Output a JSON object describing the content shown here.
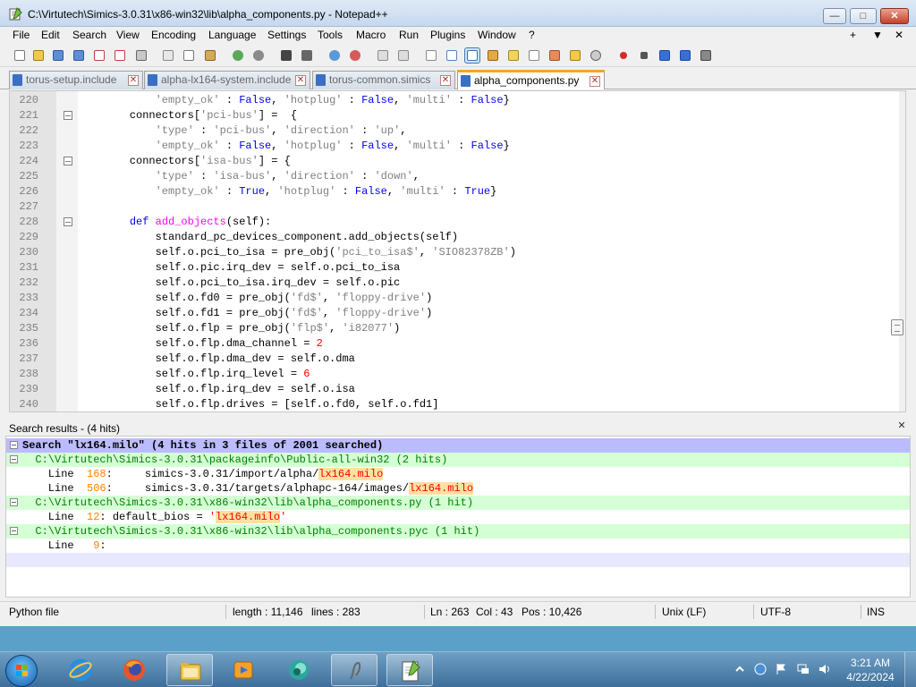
{
  "window": {
    "title": "C:\\Virtutech\\Simics-3.0.31\\x86-win32\\lib\\alpha_components.py - Notepad++",
    "min_label": "—",
    "max_label": "□",
    "close_label": "✕"
  },
  "menu": [
    "File",
    "Edit",
    "Search",
    "View",
    "Encoding",
    "Language",
    "Settings",
    "Tools",
    "Macro",
    "Run",
    "Plugins",
    "Window",
    "?"
  ],
  "menu_right": [
    "+",
    "▼",
    "✕"
  ],
  "tabs": [
    {
      "label": "torus-setup.include"
    },
    {
      "label": "alpha-lx164-system.include"
    },
    {
      "label": "torus-common.simics"
    },
    {
      "label": "alpha_components.py"
    }
  ],
  "code_lines": [
    {
      "n": "220",
      "parts": [
        [
          "p",
          "        "
        ],
        [
          "s",
          "'empty_ok'"
        ],
        [
          "p",
          " : "
        ],
        [
          "k",
          "False"
        ],
        [
          "p",
          ", "
        ],
        [
          "s",
          "'hotplug'"
        ],
        [
          "p",
          " : "
        ],
        [
          "k",
          "False"
        ],
        [
          "p",
          ", "
        ],
        [
          "s",
          "'multi'"
        ],
        [
          "p",
          " : "
        ],
        [
          "k",
          "False"
        ],
        [
          "p",
          "}"
        ]
      ]
    },
    {
      "n": "221",
      "fold": true,
      "parts": [
        [
          "p",
          "    connectors["
        ],
        [
          "s",
          "'pci-bus'"
        ],
        [
          "p",
          "] =  {"
        ]
      ]
    },
    {
      "n": "222",
      "parts": [
        [
          "p",
          "        "
        ],
        [
          "s",
          "'type'"
        ],
        [
          "p",
          " : "
        ],
        [
          "s",
          "'pci-bus'"
        ],
        [
          "p",
          ", "
        ],
        [
          "s",
          "'direction'"
        ],
        [
          "p",
          " : "
        ],
        [
          "s",
          "'up'"
        ],
        [
          "p",
          ","
        ]
      ]
    },
    {
      "n": "223",
      "parts": [
        [
          "p",
          "        "
        ],
        [
          "s",
          "'empty_ok'"
        ],
        [
          "p",
          " : "
        ],
        [
          "k",
          "False"
        ],
        [
          "p",
          ", "
        ],
        [
          "s",
          "'hotplug'"
        ],
        [
          "p",
          " : "
        ],
        [
          "k",
          "False"
        ],
        [
          "p",
          ", "
        ],
        [
          "s",
          "'multi'"
        ],
        [
          "p",
          " : "
        ],
        [
          "k",
          "False"
        ],
        [
          "p",
          "}"
        ]
      ]
    },
    {
      "n": "224",
      "fold": true,
      "parts": [
        [
          "p",
          "    connectors["
        ],
        [
          "s",
          "'isa-bus'"
        ],
        [
          "p",
          "] = {"
        ]
      ]
    },
    {
      "n": "225",
      "parts": [
        [
          "p",
          "        "
        ],
        [
          "s",
          "'type'"
        ],
        [
          "p",
          " : "
        ],
        [
          "s",
          "'isa-bus'"
        ],
        [
          "p",
          ", "
        ],
        [
          "s",
          "'direction'"
        ],
        [
          "p",
          " : "
        ],
        [
          "s",
          "'down'"
        ],
        [
          "p",
          ","
        ]
      ]
    },
    {
      "n": "226",
      "parts": [
        [
          "p",
          "        "
        ],
        [
          "s",
          "'empty_ok'"
        ],
        [
          "p",
          " : "
        ],
        [
          "k",
          "True"
        ],
        [
          "p",
          ", "
        ],
        [
          "s",
          "'hotplug'"
        ],
        [
          "p",
          " : "
        ],
        [
          "k",
          "False"
        ],
        [
          "p",
          ", "
        ],
        [
          "s",
          "'multi'"
        ],
        [
          "p",
          " : "
        ],
        [
          "k",
          "True"
        ],
        [
          "p",
          "}"
        ]
      ]
    },
    {
      "n": "227",
      "parts": []
    },
    {
      "n": "228",
      "fold": true,
      "parts": [
        [
          "p",
          "    "
        ],
        [
          "k",
          "def"
        ],
        [
          "p",
          " "
        ],
        [
          "f",
          "add_objects"
        ],
        [
          "p",
          "(self):"
        ]
      ]
    },
    {
      "n": "229",
      "parts": [
        [
          "p",
          "        standard_pc_devices_component.add_objects(self)"
        ]
      ]
    },
    {
      "n": "230",
      "parts": [
        [
          "p",
          "        self.o.pci_to_isa = pre_obj("
        ],
        [
          "s",
          "'pci_to_isa$'"
        ],
        [
          "p",
          ", "
        ],
        [
          "s",
          "'SIO82378ZB'"
        ],
        [
          "p",
          ")"
        ]
      ]
    },
    {
      "n": "231",
      "parts": [
        [
          "p",
          "        self.o.pic.irq_dev = self.o.pci_to_isa"
        ]
      ]
    },
    {
      "n": "232",
      "parts": [
        [
          "p",
          "        self.o.pci_to_isa.irq_dev = self.o.pic"
        ]
      ]
    },
    {
      "n": "233",
      "parts": [
        [
          "p",
          "        self.o.fd0 = pre_obj("
        ],
        [
          "s",
          "'fd$'"
        ],
        [
          "p",
          ", "
        ],
        [
          "s",
          "'floppy-drive'"
        ],
        [
          "p",
          ")"
        ]
      ]
    },
    {
      "n": "234",
      "parts": [
        [
          "p",
          "        self.o.fd1 = pre_obj("
        ],
        [
          "s",
          "'fd$'"
        ],
        [
          "p",
          ", "
        ],
        [
          "s",
          "'floppy-drive'"
        ],
        [
          "p",
          ")"
        ]
      ]
    },
    {
      "n": "235",
      "parts": [
        [
          "p",
          "        self.o.flp = pre_obj("
        ],
        [
          "s",
          "'flp$'"
        ],
        [
          "p",
          ", "
        ],
        [
          "s",
          "'i82077'"
        ],
        [
          "p",
          ")"
        ]
      ]
    },
    {
      "n": "236",
      "parts": [
        [
          "p",
          "        self.o.flp.dma_channel = "
        ],
        [
          "n",
          "2"
        ]
      ]
    },
    {
      "n": "237",
      "parts": [
        [
          "p",
          "        self.o.flp.dma_dev = self.o.dma"
        ]
      ]
    },
    {
      "n": "238",
      "parts": [
        [
          "p",
          "        self.o.flp.irq_level = "
        ],
        [
          "n",
          "6"
        ]
      ]
    },
    {
      "n": "239",
      "parts": [
        [
          "p",
          "        self.o.flp.irq_dev = self.o.isa"
        ]
      ]
    },
    {
      "n": "240",
      "parts": [
        [
          "p",
          "        self.o.flp.drives = [self.o.fd0, self.o.fd1]"
        ]
      ]
    }
  ],
  "search_results": {
    "title": "Search results - (4 hits)",
    "close_label": "✕",
    "lines": [
      {
        "kind": "search",
        "tree": true,
        "parts": [
          [
            "p",
            "Search \"lx164.milo\" (4 hits in 3 files of 2001 searched)"
          ]
        ]
      },
      {
        "kind": "file",
        "tree": true,
        "parts": [
          [
            "p",
            "  C:\\Virtutech\\Simics-3.0.31\\packageinfo\\Public-all-win32 (2 hits)"
          ]
        ]
      },
      {
        "kind": "line",
        "parts": [
          [
            "p",
            "    Line  "
          ],
          [
            "l",
            "168"
          ],
          [
            "p",
            ":     simics-3.0.31/import/alpha/"
          ],
          [
            "h",
            "lx164.milo"
          ]
        ]
      },
      {
        "kind": "line",
        "parts": [
          [
            "p",
            "    Line  "
          ],
          [
            "l",
            "506"
          ],
          [
            "p",
            ":     simics-3.0.31/targets/alphapc-164/images/"
          ],
          [
            "h",
            "lx164.milo"
          ]
        ]
      },
      {
        "kind": "file",
        "tree": true,
        "parts": [
          [
            "p",
            "  C:\\Virtutech\\Simics-3.0.31\\x86-win32\\lib\\alpha_components.py (1 hit)"
          ]
        ]
      },
      {
        "kind": "line",
        "parts": [
          [
            "p",
            "    Line  "
          ],
          [
            "l",
            "12"
          ],
          [
            "p",
            ": default_bios = "
          ],
          [
            "s",
            "'"
          ],
          [
            "h",
            "lx164.milo"
          ],
          [
            "s",
            "'"
          ]
        ]
      },
      {
        "kind": "file",
        "tree": true,
        "parts": [
          [
            "p",
            "  C:\\Virtutech\\Simics-3.0.31\\x86-win32\\lib\\alpha_components.pyc (1 hit)"
          ]
        ]
      },
      {
        "kind": "line",
        "parts": [
          [
            "p",
            "    Line   "
          ],
          [
            "l",
            "9"
          ],
          [
            "p",
            ":"
          ]
        ]
      },
      {
        "kind": "cur",
        "parts": []
      }
    ]
  },
  "status": {
    "file_type": "Python file",
    "length": "length : 11,146",
    "lines": "lines : 283",
    "ln": "Ln : 263",
    "col": "Col : 43",
    "pos": "Pos : 10,426",
    "eol": "Unix (LF)",
    "encoding": "UTF-8",
    "mode": "INS"
  },
  "taskbar": {
    "time": "3:21 AM",
    "date": "4/22/2024",
    "icons": [
      "internet-explorer-icon",
      "firefox-icon",
      "explorer-folder-icon",
      "media-player-icon",
      "teal-app-icon",
      "scribble-app-icon",
      "notepadplusplus-icon"
    ]
  },
  "colors": {
    "keyword": "#0000ff",
    "function": "#ff00ff",
    "string": "#808080",
    "number": "#ff0000",
    "search_header_bg": "#bbbbff",
    "file_row_bg": "#d5ffd5",
    "tab_active_accent": "#f5a623"
  }
}
